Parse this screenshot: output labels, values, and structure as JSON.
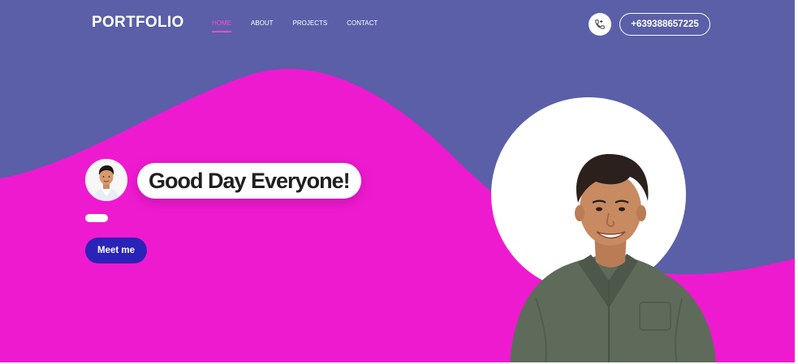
{
  "header": {
    "brand": "PORTFOLIO",
    "nav": [
      {
        "label": "HOME",
        "active": true
      },
      {
        "label": "ABOUT",
        "active": false
      },
      {
        "label": "PROJECTS",
        "active": false
      },
      {
        "label": "CONTACT",
        "active": false
      }
    ],
    "phone_icon": "phone-icon",
    "phone_number": "+639388657225"
  },
  "hero": {
    "greeting": "Good Day Everyone!",
    "cta_label": "Meet me",
    "avatar_icon": "avatar",
    "portrait": "profile-photo"
  },
  "colors": {
    "background": "#5a5fa8",
    "wave": "#ee1ad0",
    "nav_active": "#ff49d6",
    "cta": "#2a23b8"
  }
}
